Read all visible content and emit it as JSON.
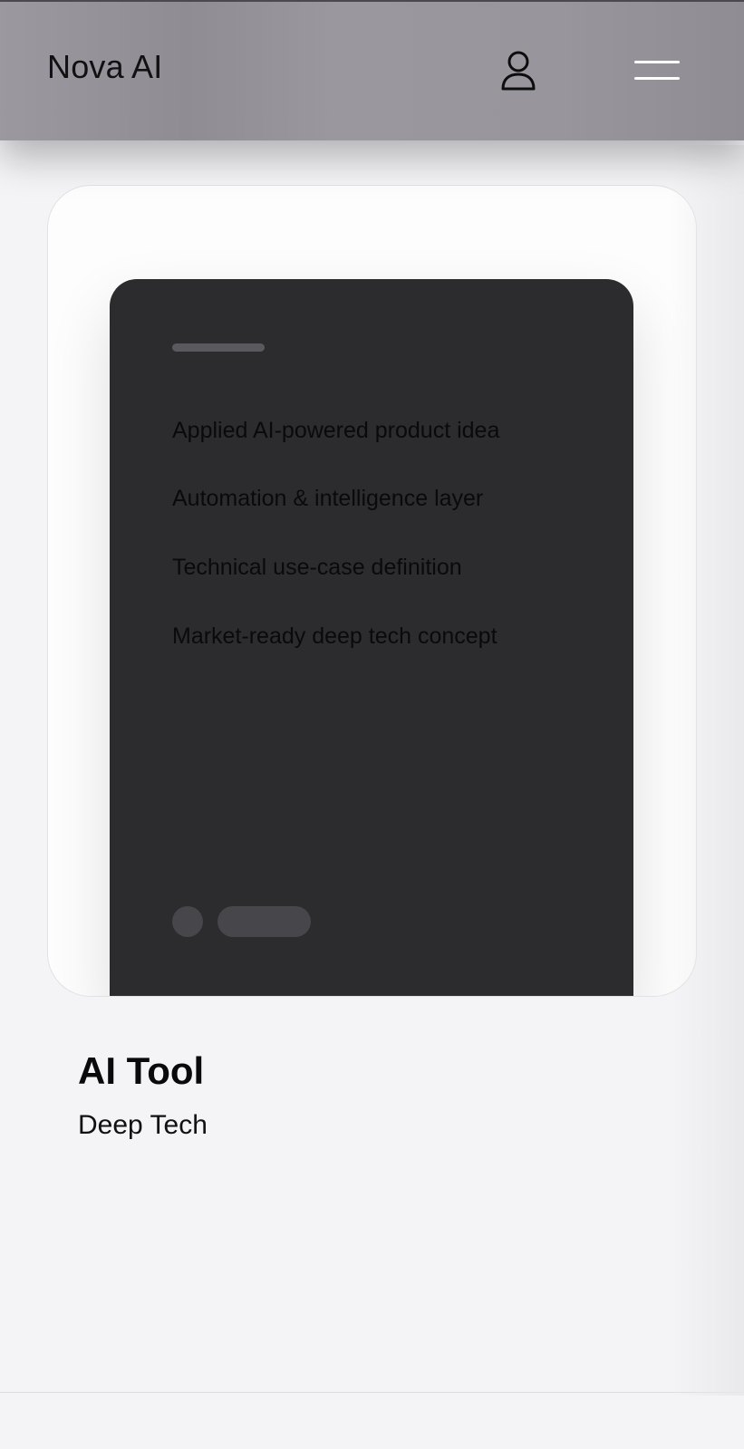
{
  "header": {
    "brand": "Nova AI",
    "user_icon": "user-icon",
    "menu_icon": "hamburger-menu-icon",
    "background": "#98969c"
  },
  "card": {
    "features": [
      "Applied AI-powered product idea",
      "Automation & intelligence layer",
      "Technical use-case definition",
      "Market-ready deep tech concept"
    ],
    "background": "#2c2c2e"
  },
  "project": {
    "title": "AI Tool",
    "category": "Deep Tech"
  }
}
